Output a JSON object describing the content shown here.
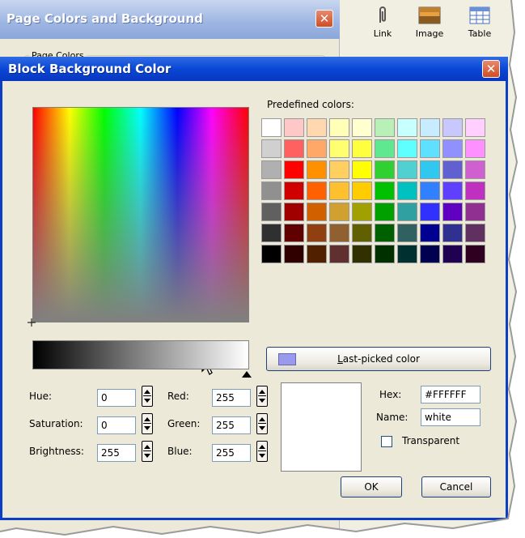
{
  "background_window": {
    "title": "Page Colors and Background",
    "group_label": "Page Colors",
    "toolbar": [
      {
        "label": "Link",
        "icon": "paperclip-icon"
      },
      {
        "label": "Image",
        "icon": "image-icon"
      },
      {
        "label": "Table",
        "icon": "table-icon"
      }
    ]
  },
  "dialog": {
    "title": "Block Background Color",
    "predefined_label": "Predefined colors:",
    "palette": [
      [
        "#ffffff",
        "#ffc8c8",
        "#ffd8b0",
        "#ffffb8",
        "#ffffd0",
        "#b8f0b8",
        "#c8ffff",
        "#c8ecff",
        "#c8c8ff",
        "#ffd0ff"
      ],
      [
        "#d0d0d0",
        "#ff6060",
        "#ffa868",
        "#ffff70",
        "#ffff40",
        "#60e890",
        "#60ffff",
        "#60e0ff",
        "#9090ff",
        "#ff90ff"
      ],
      [
        "#b0b0b0",
        "#ff0000",
        "#ff9000",
        "#ffd060",
        "#ffff00",
        "#30d030",
        "#50d0d0",
        "#30c8f0",
        "#6060d0",
        "#d060d0"
      ],
      [
        "#909090",
        "#d00000",
        "#ff6000",
        "#ffc030",
        "#ffcc00",
        "#00c000",
        "#00c0c0",
        "#3080ff",
        "#6040ff",
        "#c030c0"
      ],
      [
        "#606060",
        "#a00000",
        "#d06000",
        "#d0a030",
        "#a0a000",
        "#00a000",
        "#30a0a0",
        "#3030ff",
        "#6000c0",
        "#903090"
      ],
      [
        "#303030",
        "#600000",
        "#904010",
        "#906030",
        "#606000",
        "#006000",
        "#306060",
        "#000090",
        "#303090",
        "#603060"
      ],
      [
        "#000000",
        "#300000",
        "#502000",
        "#603030",
        "#303000",
        "#003000",
        "#003030",
        "#000050",
        "#200050",
        "#300020"
      ]
    ],
    "last_picked_label": "Last-picked color",
    "last_picked_color": "#9999ee",
    "hsb": {
      "hue_label": "Hue:",
      "hue": "0",
      "saturation_label": "Saturation:",
      "saturation": "0",
      "brightness_label": "Brightness:",
      "brightness": "255"
    },
    "rgb": {
      "red_label": "Red:",
      "red": "255",
      "green_label": "Green:",
      "green": "255",
      "blue_label": "Blue:",
      "blue": "255"
    },
    "hex_label": "Hex:",
    "hex": "#FFFFFF",
    "name_label": "Name:",
    "name": "white",
    "transparent_label": "Transparent",
    "transparent_checked": false,
    "preview_color": "#ffffff",
    "ok_label": "OK",
    "cancel_label": "Cancel"
  }
}
